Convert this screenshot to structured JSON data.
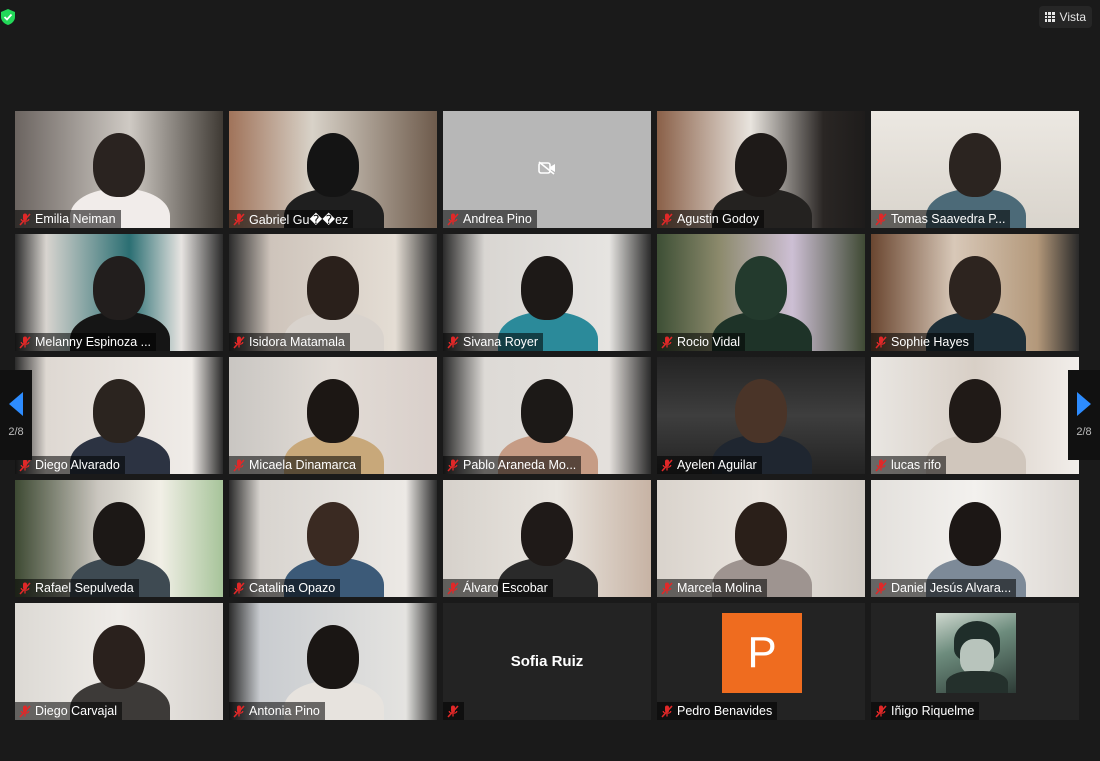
{
  "header": {
    "vista_label": "Vista",
    "security_color": "#23d959"
  },
  "pagination": {
    "left_label": "2/8",
    "right_label": "2/8",
    "arrow_color": "#2d8cff"
  },
  "participants": [
    {
      "name": "Emilia Neiman",
      "muted": true,
      "video": "on"
    },
    {
      "name": "Gabriel Gu��ez",
      "muted": true,
      "video": "on"
    },
    {
      "name": "Andrea Pino",
      "muted": true,
      "video": "disabled"
    },
    {
      "name": "Agustin Godoy",
      "muted": true,
      "video": "on"
    },
    {
      "name": "Tomas Saavedra P...",
      "muted": true,
      "video": "on"
    },
    {
      "name": "Melanny Espinoza ...",
      "muted": true,
      "video": "on"
    },
    {
      "name": "Isidora Matamala",
      "muted": true,
      "video": "on"
    },
    {
      "name": "Sivana Royer",
      "muted": true,
      "video": "on"
    },
    {
      "name": "Rocio Vidal",
      "muted": true,
      "video": "on"
    },
    {
      "name": "Sophie Hayes",
      "muted": true,
      "video": "on"
    },
    {
      "name": "Diego Alvarado",
      "muted": true,
      "video": "on"
    },
    {
      "name": "Micaela Dinamarca",
      "muted": true,
      "video": "on"
    },
    {
      "name": "Pablo Araneda Mo...",
      "muted": true,
      "video": "on"
    },
    {
      "name": "Ayelen Aguilar",
      "muted": true,
      "video": "on"
    },
    {
      "name": "lucas rifo",
      "muted": true,
      "video": "on"
    },
    {
      "name": "Rafael Sepulveda",
      "muted": true,
      "video": "on"
    },
    {
      "name": "Catalina Opazo",
      "muted": true,
      "video": "on"
    },
    {
      "name": "Álvaro Escobar",
      "muted": true,
      "video": "on"
    },
    {
      "name": "Marcela Molina",
      "muted": true,
      "video": "on"
    },
    {
      "name": "Daniel Jesús Alvara...",
      "muted": true,
      "video": "on"
    },
    {
      "name": "Diego Carvajal",
      "muted": true,
      "video": "on"
    },
    {
      "name": "Antonia Pino",
      "muted": true,
      "video": "on"
    },
    {
      "name": "Sofia Ruiz",
      "muted": true,
      "video": "off",
      "tag_name": ""
    },
    {
      "name": "Pedro Benavides",
      "muted": true,
      "video": "off",
      "avatar_letter": "P",
      "avatar_color": "#ef6c1f"
    },
    {
      "name": "Iñigo Riquelme",
      "muted": true,
      "video": "off",
      "avatar": "image"
    }
  ]
}
